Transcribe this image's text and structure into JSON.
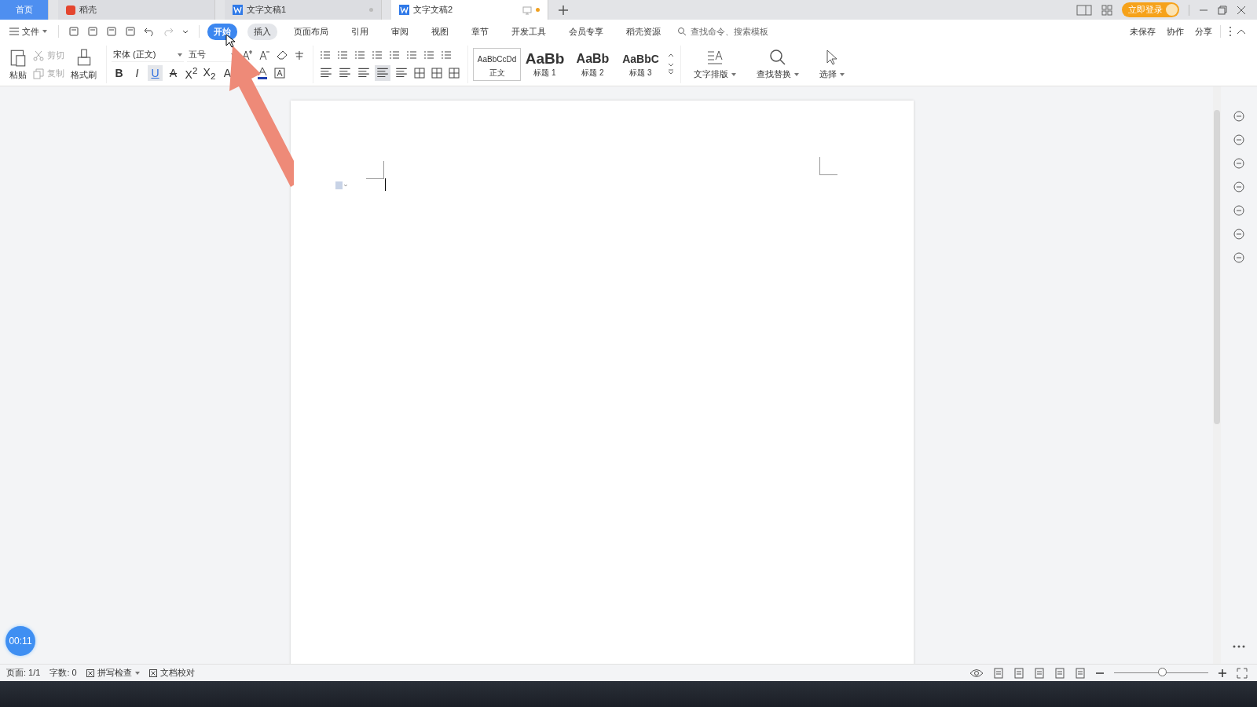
{
  "title_tabs": [
    {
      "label": "首页",
      "kind": "home",
      "selected": false
    },
    {
      "label": "稻壳",
      "kind": "app",
      "selected": false
    },
    {
      "label": "文字文稿1",
      "kind": "doc",
      "selected": false
    },
    {
      "label": "文字文稿2",
      "kind": "doc",
      "selected": true
    }
  ],
  "login_button": "立即登录",
  "file_menu": "文件",
  "menu_tabs": [
    {
      "label": "开始",
      "selected": true
    },
    {
      "label": "插入",
      "selected": false
    },
    {
      "label": "页面布局",
      "selected": false
    },
    {
      "label": "引用",
      "selected": false
    },
    {
      "label": "审阅",
      "selected": false
    },
    {
      "label": "视图",
      "selected": false
    },
    {
      "label": "章节",
      "selected": false
    },
    {
      "label": "开发工具",
      "selected": false
    },
    {
      "label": "会员专享",
      "selected": false
    },
    {
      "label": "稻壳资源",
      "selected": false
    }
  ],
  "search": {
    "placeholder": "查找命令、搜索模板"
  },
  "header_actions": [
    "未保存",
    "协作",
    "分享"
  ],
  "clipboard": {
    "paste": "粘贴",
    "cut": {
      "label": "剪切",
      "disabled": true
    },
    "copy": {
      "label": "复制",
      "disabled": true
    },
    "format_painter": "格式刷"
  },
  "font": {
    "family": "宋体 (正文)",
    "size": "五号"
  },
  "font_format": [
    {
      "label": "B",
      "kind": "bold",
      "selected": false
    },
    {
      "label": "I",
      "kind": "italic",
      "selected": false
    },
    {
      "label": "U",
      "kind": "underline",
      "selected": true
    },
    {
      "label": "A",
      "kind": "strike",
      "selected": false
    },
    {
      "label": "X$^{2}$",
      "kind": "plain",
      "selected": false
    },
    {
      "label": "X$_{2}$",
      "kind": "plain",
      "selected": false
    },
    {
      "label": "A",
      "kind": "plain",
      "selected": false
    }
  ],
  "alignment": [
    {
      "selected": false
    },
    {
      "selected": false
    },
    {
      "selected": false
    },
    {
      "selected": true
    },
    {
      "selected": false
    }
  ],
  "styles": [
    {
      "preview": "AaBbCcDd",
      "label": "正文",
      "kind": "body",
      "selected": true
    },
    {
      "preview": "AaBb",
      "label": "标题 1",
      "kind": "h1",
      "selected": false
    },
    {
      "preview": "AaBb",
      "label": "标题 2",
      "kind": "h2",
      "selected": false
    },
    {
      "preview": "AaBbC",
      "label": "标题 3",
      "kind": "h3",
      "selected": false
    }
  ],
  "large_buttons": [
    {
      "label": "文字排版",
      "kind": "layout"
    },
    {
      "label": "查找替换",
      "kind": "find"
    },
    {
      "label": "选择",
      "kind": "select"
    }
  ],
  "timer": "00:11",
  "status_bar": {
    "page": "页面: 1/1",
    "words": "字数: 0",
    "spell_check": "拼写检查",
    "proofread": "文档校对"
  },
  "zoom_slider": {
    "level": 0.52
  }
}
